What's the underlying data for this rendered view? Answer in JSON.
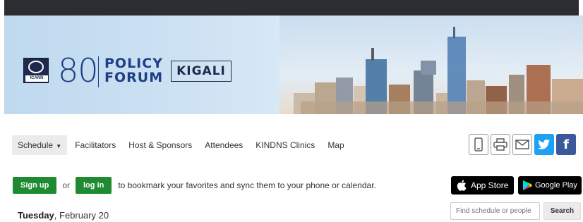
{
  "banner": {
    "logo_org_text": "ICANN",
    "logo_number": "80",
    "logo_policy_forum_line1": "POLICY",
    "logo_policy_forum_line2": "FORUM",
    "city": "KIGALI"
  },
  "nav": {
    "items": [
      {
        "label": "Schedule",
        "active": true
      },
      {
        "label": "Facilitators"
      },
      {
        "label": "Host & Sponsors"
      },
      {
        "label": "Attendees"
      },
      {
        "label": "KINDNS Clinics"
      },
      {
        "label": "Map"
      }
    ]
  },
  "share": {
    "icons": [
      "mobile-icon",
      "print-icon",
      "email-icon",
      "twitter-icon",
      "facebook-icon"
    ],
    "facebook_glyph": "f"
  },
  "signup": {
    "signup_label": "Sign up",
    "or_text": "or",
    "login_label": "log in",
    "bookmark_text": "to bookmark your favorites and sync them to your phone or calendar."
  },
  "stores": {
    "apple_label": "App Store",
    "google_label": "Google Play"
  },
  "date": {
    "weekday": "Tuesday",
    "rest": ", February 20"
  },
  "search": {
    "placeholder": "Find schedule or people",
    "button_label": "Search"
  },
  "colors": {
    "green_button": "#1e8b32",
    "brand_blue": "#1d3f86",
    "twitter": "#1da1f2",
    "facebook": "#3b5998"
  }
}
